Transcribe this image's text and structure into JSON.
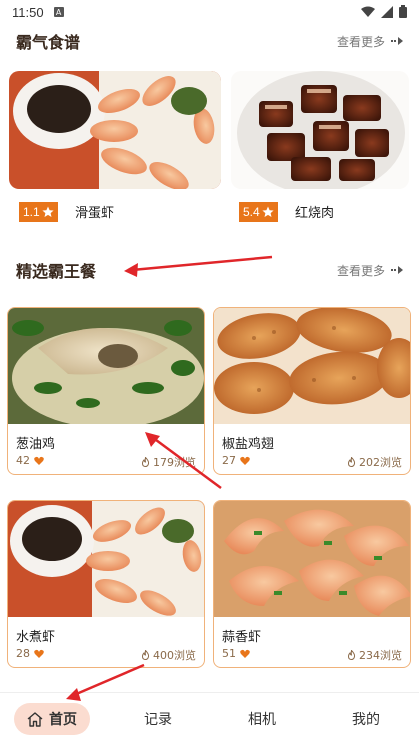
{
  "status": {
    "time": "11:50",
    "notif_glyph": "A"
  },
  "section1": {
    "title": "霸气食谱",
    "more": "查看更多"
  },
  "recipes": [
    {
      "rating": "1.1",
      "name": "滑蛋虾"
    },
    {
      "rating": "5.4",
      "name": "红烧肉"
    }
  ],
  "section2": {
    "title": "精选霸王餐",
    "more": "查看更多"
  },
  "meals": [
    {
      "name": "葱油鸡",
      "likes": "42",
      "views": "179浏览"
    },
    {
      "name": "椒盐鸡翅",
      "likes": "27",
      "views": "202浏览"
    },
    {
      "name": "水煮虾",
      "likes": "28",
      "views": "400浏览"
    },
    {
      "name": "蒜香虾",
      "likes": "51",
      "views": "234浏览"
    }
  ],
  "nav": {
    "home": "首页",
    "records": "记录",
    "camera": "相机",
    "mine": "我的"
  },
  "colors": {
    "accent": "#e8751a",
    "annotation": "#e0262a",
    "home_pill": "#fbdcd0",
    "card_border": "#f0b27a"
  }
}
